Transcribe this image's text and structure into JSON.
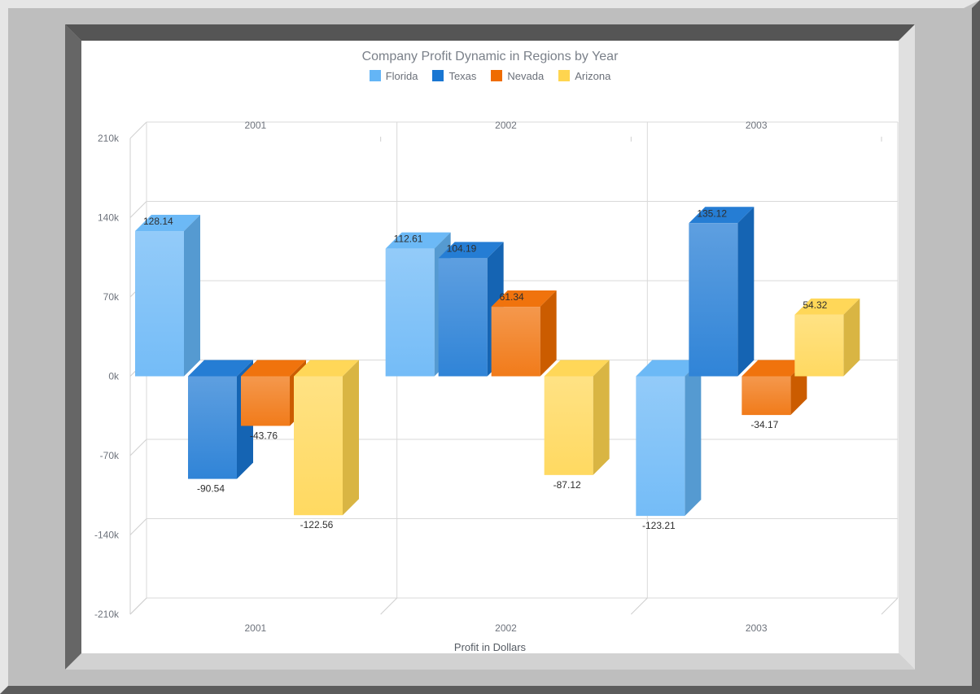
{
  "chart_data": {
    "type": "bar",
    "title": "Company Profit Dynamic in Regions by Year",
    "xlabel": "Profit in Dollars",
    "ylabel": "",
    "categories": [
      "2001",
      "2002",
      "2003"
    ],
    "series": [
      {
        "name": "Florida",
        "color": "#64b5f6",
        "values": [
          128.14,
          112.61,
          -123.21
        ]
      },
      {
        "name": "Texas",
        "color": "#1976d2",
        "values": [
          -90.54,
          104.19,
          135.12
        ]
      },
      {
        "name": "Nevada",
        "color": "#ef6c00",
        "values": [
          -43.76,
          61.34,
          -34.17
        ]
      },
      {
        "name": "Arizona",
        "color": "#ffd54f",
        "values": [
          -122.56,
          -87.12,
          54.32
        ]
      }
    ],
    "value_unit_note": "",
    "yticks": [
      "210k",
      "140k",
      "70k",
      "0k",
      "-70k",
      "-140k",
      "-210k"
    ],
    "ylim": [
      -210,
      210
    ],
    "grid": true,
    "legend_position": "top",
    "colors": {
      "frame_dark": "#5a5a5a",
      "frame_light": "#dcdcdc",
      "plot_bg": "#ffffff"
    }
  }
}
